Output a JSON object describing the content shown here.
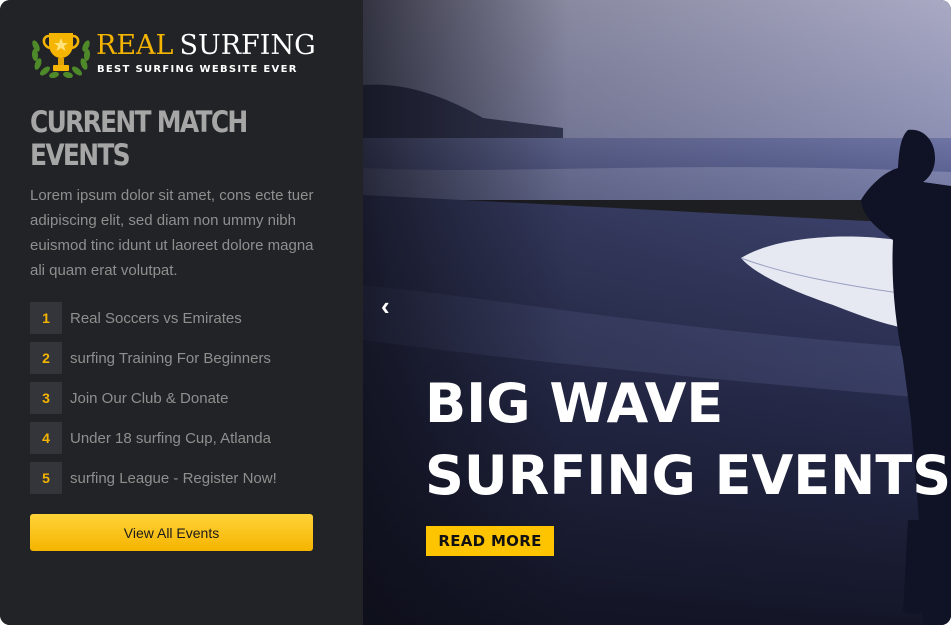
{
  "brand": {
    "name_part1": "REAL",
    "name_part2": "SURFING",
    "tagline": "BEST SURFING WEBSITE EVER",
    "logo_icon": "trophy-laurel-icon"
  },
  "sidebar": {
    "heading_line1": "CURRENT MATCH",
    "heading_line2": "EVENTS",
    "description": "Lorem ipsum dolor sit amet, cons ecte tuer adipiscing elit, sed diam non ummy nibh euismod tinc idunt ut laoreet dolore magna ali quam erat volutpat.",
    "events": [
      {
        "num": "1",
        "label": "Real Soccers vs Emirates"
      },
      {
        "num": "2",
        "label": "surfing Training For Beginners"
      },
      {
        "num": "3",
        "label": "Join Our Club & Donate"
      },
      {
        "num": "4",
        "label": "Under 18 surfing Cup, Atlanda"
      },
      {
        "num": "5",
        "label": "surfing League - Register Now!"
      }
    ],
    "view_all_label": "View All Events"
  },
  "hero": {
    "prev_arrow": "‹",
    "title_line1": "BIG WAVE",
    "title_line2": "SURFING EVENTS",
    "read_more_label": "READ MORE"
  },
  "colors": {
    "accent": "#f5b400",
    "sidebar_bg": "#222326",
    "number_box_bg": "#33353a",
    "text_muted": "#8f8f8f"
  }
}
